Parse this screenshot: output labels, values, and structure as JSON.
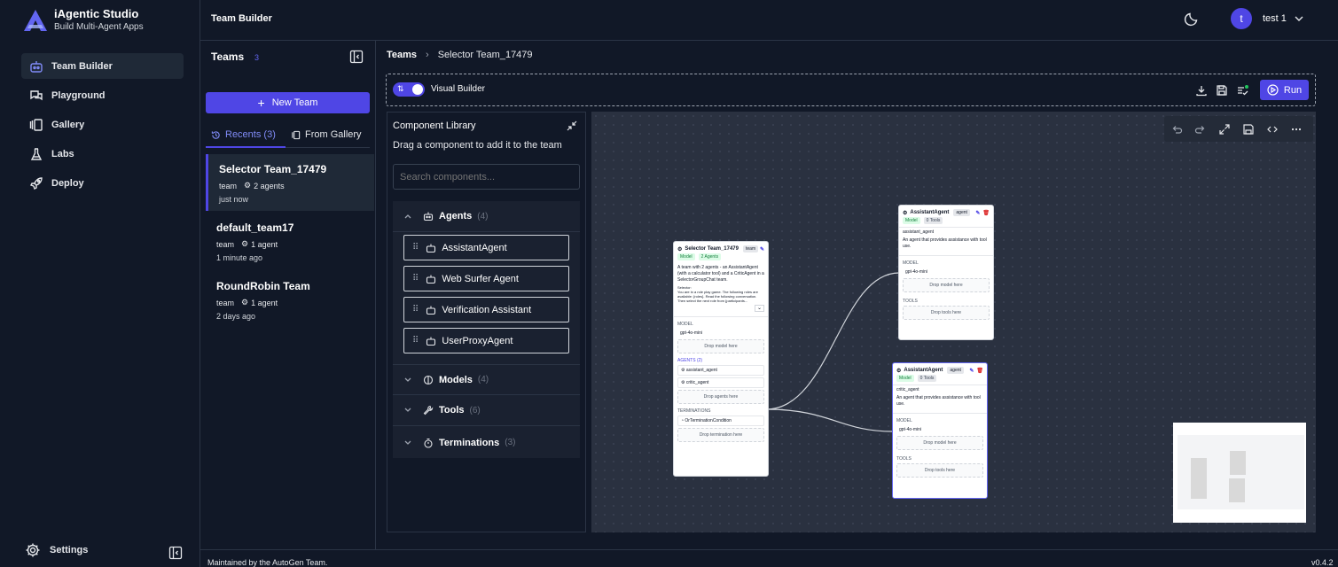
{
  "brand": {
    "name": "iAgentic Studio",
    "subtitle": "Build Multi-Agent Apps"
  },
  "nav": [
    {
      "label": "Team Builder",
      "icon": "robot-icon",
      "active": true
    },
    {
      "label": "Playground",
      "icon": "chat-icon"
    },
    {
      "label": "Gallery",
      "icon": "gallery-icon"
    },
    {
      "label": "Labs",
      "icon": "flask-icon"
    },
    {
      "label": "Deploy",
      "icon": "rocket-icon"
    }
  ],
  "settings_label": "Settings",
  "topbar": {
    "title": "Team Builder",
    "user_initial": "t",
    "user_name": "test 1"
  },
  "teams": {
    "title": "Teams",
    "count": "3",
    "new_team_label": "New Team",
    "tab_recents": "Recents (3)",
    "tab_gallery": "From Gallery",
    "items": [
      {
        "name": "Selector Team_17479",
        "type": "team",
        "agents": "2 agents",
        "time": "just now"
      },
      {
        "name": "default_team17",
        "type": "team",
        "agents": "1 agent",
        "time": "1 minute ago"
      },
      {
        "name": "RoundRobin Team",
        "type": "team",
        "agents": "1 agent",
        "time": "2 days ago"
      }
    ]
  },
  "breadcrumb": {
    "root": "Teams",
    "current": "Selector Team_17479"
  },
  "builder": {
    "visual_builder_label": "Visual Builder",
    "run_label": "Run"
  },
  "library": {
    "title": "Component Library",
    "subtitle": "Drag a component to add it to the team",
    "search_placeholder": "Search components...",
    "sections": [
      {
        "label": "Agents",
        "count": "(4)"
      },
      {
        "label": "Models",
        "count": "(4)"
      },
      {
        "label": "Tools",
        "count": "(6)"
      },
      {
        "label": "Terminations",
        "count": "(3)"
      }
    ],
    "agents": [
      "AssistantAgent",
      "Web Surfer Agent",
      "Verification Assistant",
      "UserProxyAgent"
    ]
  },
  "team_node": {
    "title": "Selector Team_17479",
    "badge": "team",
    "model_badge": "Model",
    "agents_badge": "2 Agents",
    "description": "A team with 2 agents - an AssistantAgent (with a calculator tool) and a CriticAgent in a SelectorGroupChat team.",
    "selector_label": "Selector:",
    "selector_text": "You are in a role play game. The following roles are available: {roles}. Read the following conversation. Then select the next role from {participants...",
    "model_label": "MODEL",
    "model_value": "gpt-4o-mini",
    "drop_model": "Drop model here",
    "agents_label": "AGENTS (2)",
    "agent1": "assistant_agent",
    "agent2": "critic_agent",
    "drop_agents": "Drop agents here",
    "terminations_label": "TERMINATIONS",
    "termination": "OrTerminationCondition",
    "drop_termination": "Drop termination here"
  },
  "agent_nodes": [
    {
      "title": "AssistantAgent",
      "badge": "agent",
      "model_badge": "Model",
      "tools_badge": "0 Tools",
      "name": "assistant_agent",
      "desc": "An agent that provides assistance with tool use.",
      "model_label": "MODEL",
      "model_value": "gpt-4o-mini",
      "drop_model": "Drop model here",
      "tools_label": "TOOLS",
      "drop_tools": "Drop tools here"
    },
    {
      "title": "AssistantAgent",
      "badge": "agent",
      "model_badge": "Model",
      "tools_badge": "0 Tools",
      "name": "critic_agent",
      "desc": "An agent that provides assistance with tool use.",
      "model_label": "MODEL",
      "model_value": "gpt-4o-mini",
      "drop_model": "Drop model here",
      "tools_label": "TOOLS",
      "drop_tools": "Drop tools here"
    }
  ],
  "footer": {
    "left": "Maintained by the AutoGen Team.",
    "version": "v0.4.2"
  },
  "colors": {
    "accent": "#4f46e5",
    "background": "#111827"
  }
}
